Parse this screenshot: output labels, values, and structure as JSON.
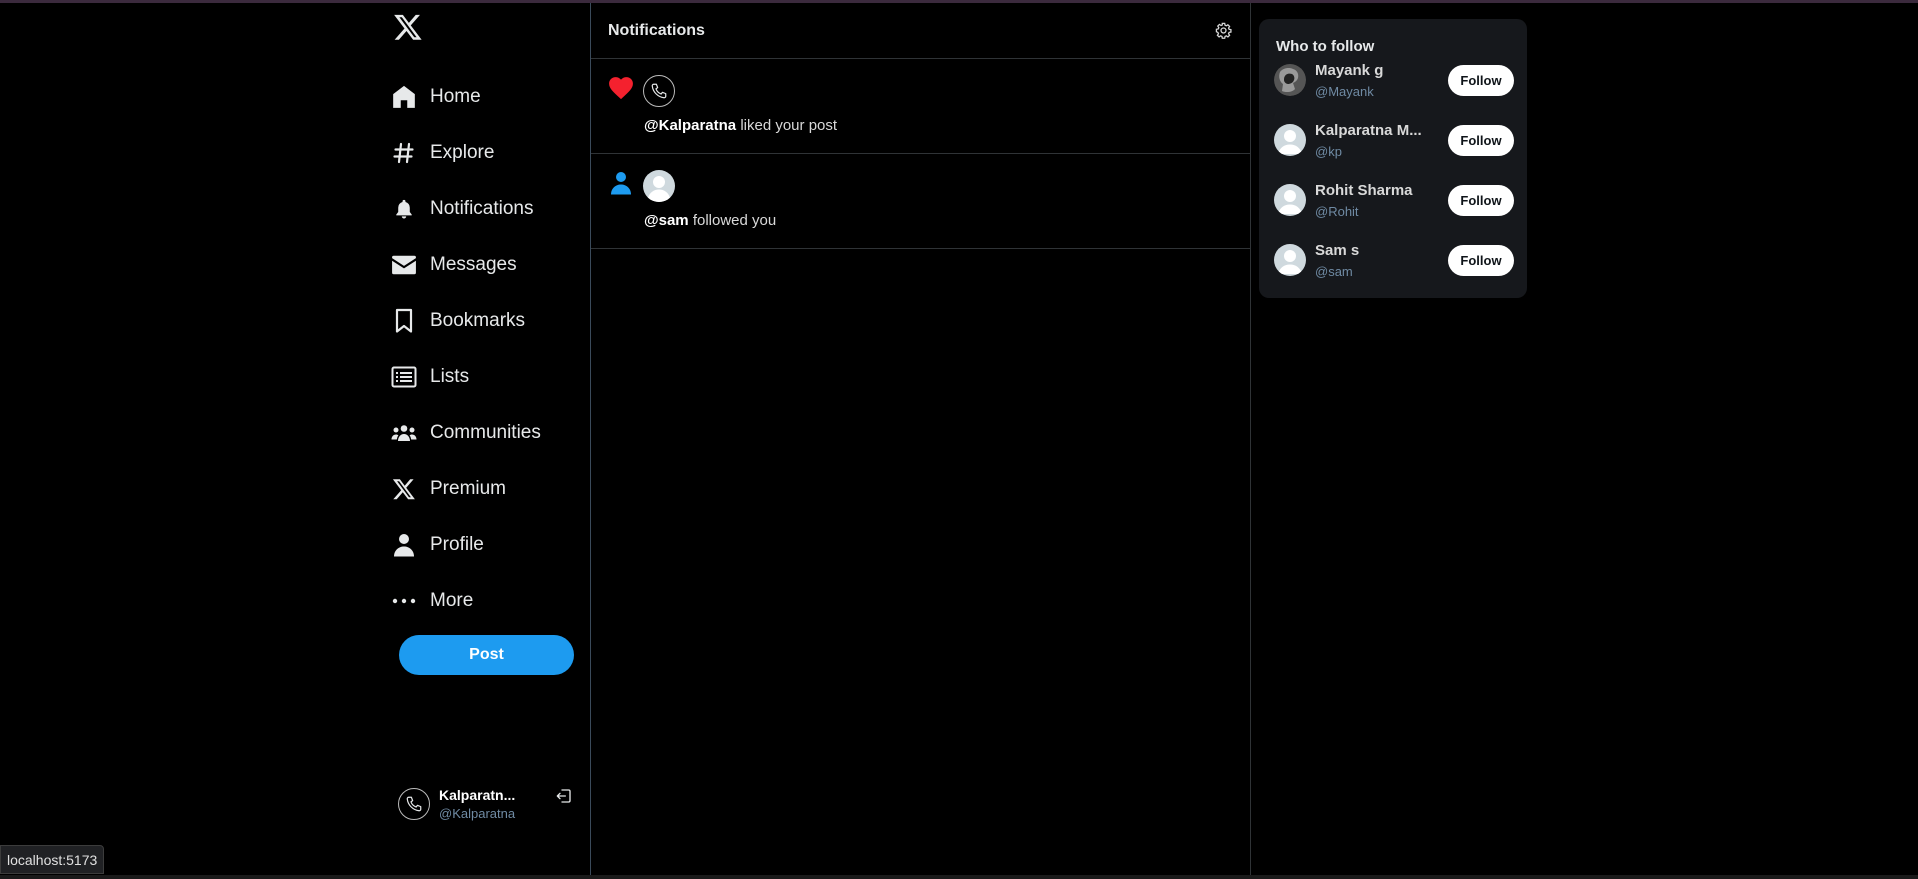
{
  "sidebar": {
    "logo": "x-logo-icon",
    "items": [
      {
        "label": "Home",
        "icon": "home-icon"
      },
      {
        "label": "Explore",
        "icon": "hashtag-icon"
      },
      {
        "label": "Notifications",
        "icon": "bell-icon"
      },
      {
        "label": "Messages",
        "icon": "envelope-icon"
      },
      {
        "label": "Bookmarks",
        "icon": "bookmark-icon"
      },
      {
        "label": "Lists",
        "icon": "list-icon"
      },
      {
        "label": "Communities",
        "icon": "people-icon"
      },
      {
        "label": "Premium",
        "icon": "x-logo-icon"
      },
      {
        "label": "Profile",
        "icon": "person-icon"
      },
      {
        "label": "More",
        "icon": "more-dots-icon"
      }
    ],
    "post_label": "Post",
    "user": {
      "name": "Kalparatn...",
      "handle": "@Kalparatna"
    }
  },
  "main": {
    "title": "Notifications",
    "notifications": [
      {
        "type": "like",
        "handle": "@Kalparatna",
        "action": " liked your post"
      },
      {
        "type": "follow",
        "handle": "@sam",
        "action": " followed you"
      }
    ]
  },
  "who_to_follow": {
    "title": "Who to follow",
    "follow_label": "Follow",
    "users": [
      {
        "name": "Mayank g",
        "handle": "@Mayank"
      },
      {
        "name": "Kalparatna M...",
        "handle": "@kp"
      },
      {
        "name": "Rohit Sharma",
        "handle": "@Rohit"
      },
      {
        "name": "Sam s",
        "handle": "@sam"
      }
    ]
  },
  "status_bar": {
    "url": "localhost:5173"
  },
  "colors": {
    "accent": "#1d9bf0",
    "like": "#f91880",
    "background": "#000000"
  }
}
